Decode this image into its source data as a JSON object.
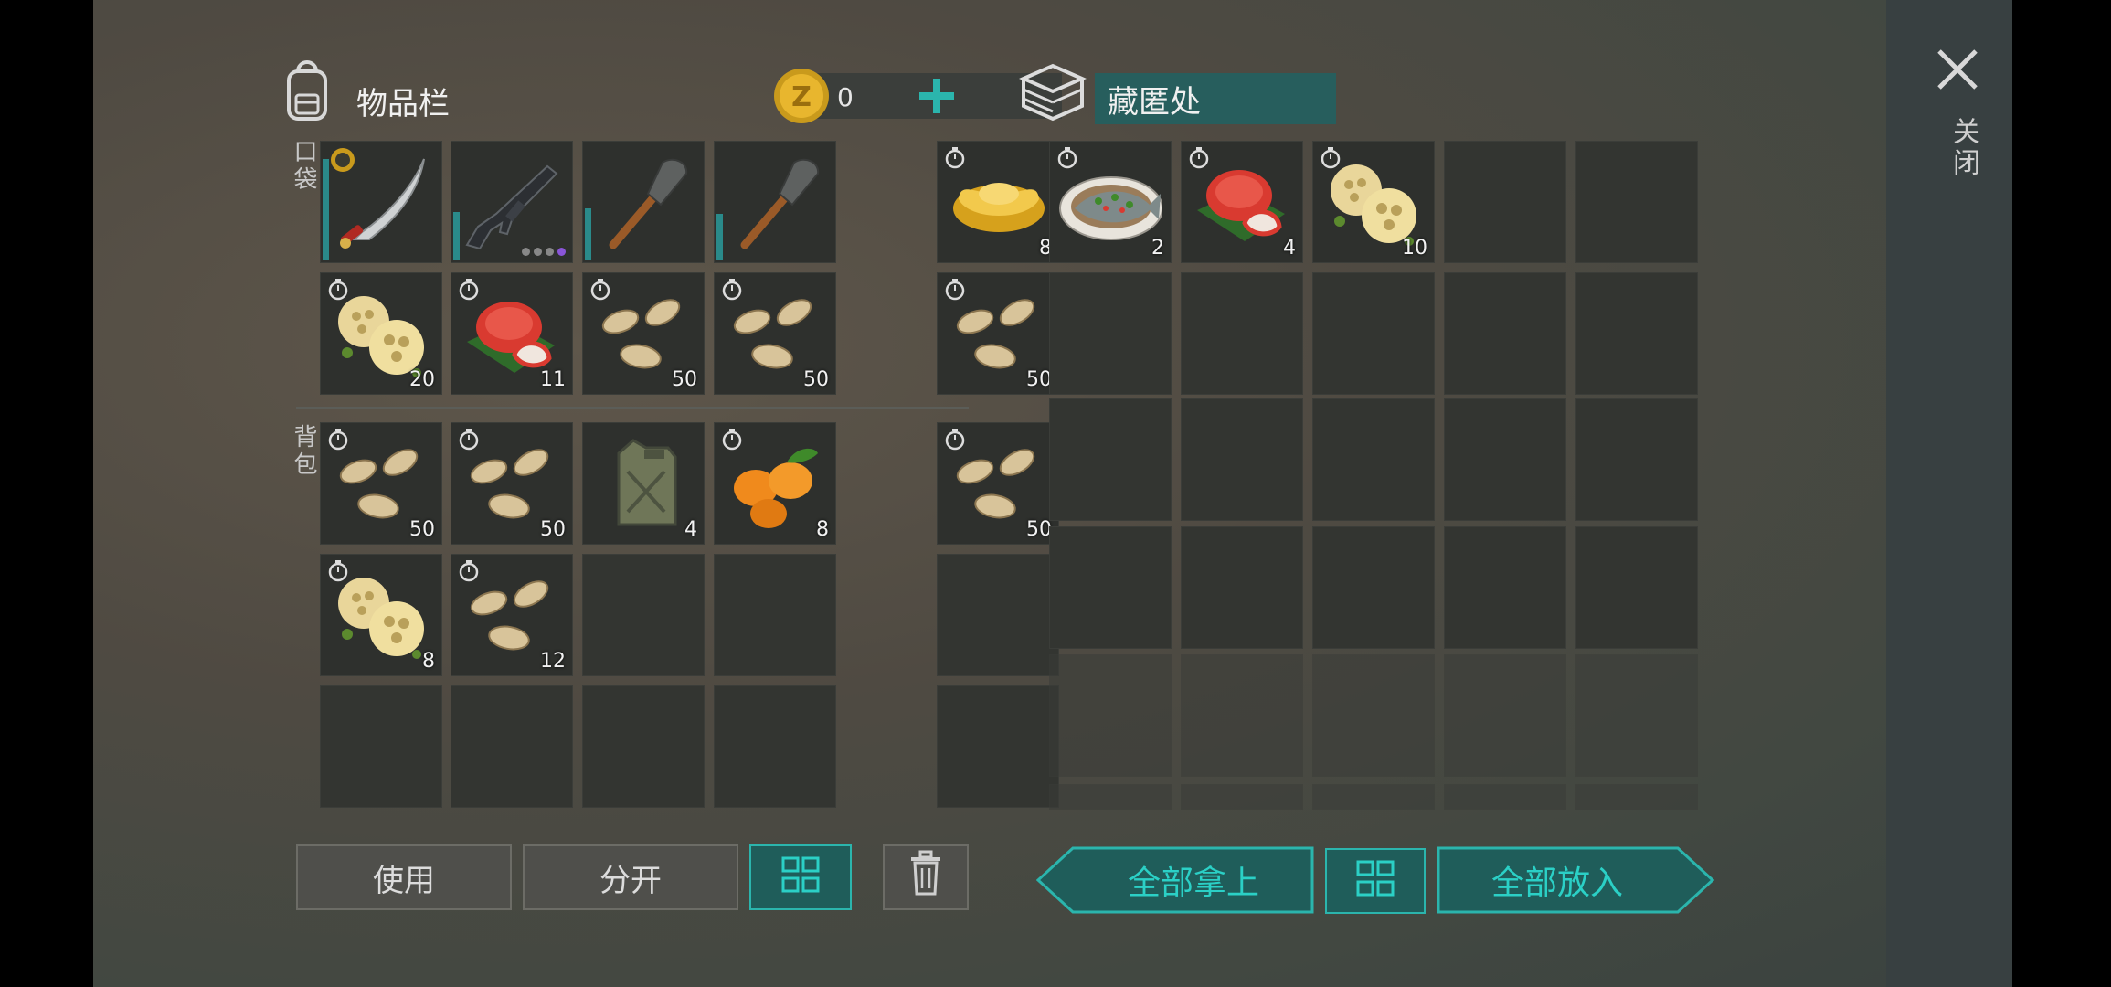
{
  "inventory": {
    "title": "物品栏",
    "coins": "0",
    "pocket_label": "口袋",
    "backpack_label": "背包",
    "pocket": [
      {
        "item": "machete",
        "icon": "machete-icon",
        "qty": "",
        "equipped": true
      },
      {
        "item": "assault-rifle",
        "icon": "rifle-icon",
        "qty": ""
      },
      {
        "item": "shovel",
        "icon": "shovel-icon",
        "qty": ""
      },
      {
        "item": "shovel",
        "icon": "shovel-icon",
        "qty": ""
      },
      {
        "item": "gold-ingot",
        "icon": "gold-ingot-icon",
        "qty": "8"
      },
      {
        "item": "lotus-root",
        "icon": "lotus-root-icon",
        "qty": "20"
      },
      {
        "item": "red-bun",
        "icon": "red-bun-icon",
        "qty": "11"
      },
      {
        "item": "seeds",
        "icon": "seeds-icon",
        "qty": "50"
      },
      {
        "item": "seeds",
        "icon": "seeds-icon",
        "qty": "50"
      },
      {
        "item": "seeds",
        "icon": "seeds-icon",
        "qty": "50"
      }
    ],
    "backpack": [
      {
        "item": "seeds",
        "icon": "seeds-icon",
        "qty": "50"
      },
      {
        "item": "seeds",
        "icon": "seeds-icon",
        "qty": "50"
      },
      {
        "item": "jerrycan",
        "icon": "jerrycan-icon",
        "qty": "4"
      },
      {
        "item": "kumquat",
        "icon": "kumquat-icon",
        "qty": "8"
      },
      {
        "item": "seeds",
        "icon": "seeds-icon",
        "qty": "50"
      },
      {
        "item": "lotus-root",
        "icon": "lotus-root-icon",
        "qty": "8"
      },
      {
        "item": "seeds",
        "icon": "seeds-icon",
        "qty": "12"
      }
    ],
    "buttons": {
      "use": "使用",
      "split": "分开"
    }
  },
  "stash": {
    "title": "藏匿处",
    "items": [
      {
        "item": "steamed-fish",
        "icon": "fish-dish-icon",
        "qty": "2"
      },
      {
        "item": "red-bun",
        "icon": "red-bun-icon",
        "qty": "4"
      },
      {
        "item": "lotus-root",
        "icon": "lotus-root-icon",
        "qty": "10"
      }
    ],
    "buttons": {
      "take_all": "全部拿上",
      "put_all": "全部放入"
    }
  },
  "close_label": "关闭",
  "colors": {
    "accent": "#2bb5ad",
    "slot": "#2e302d"
  }
}
